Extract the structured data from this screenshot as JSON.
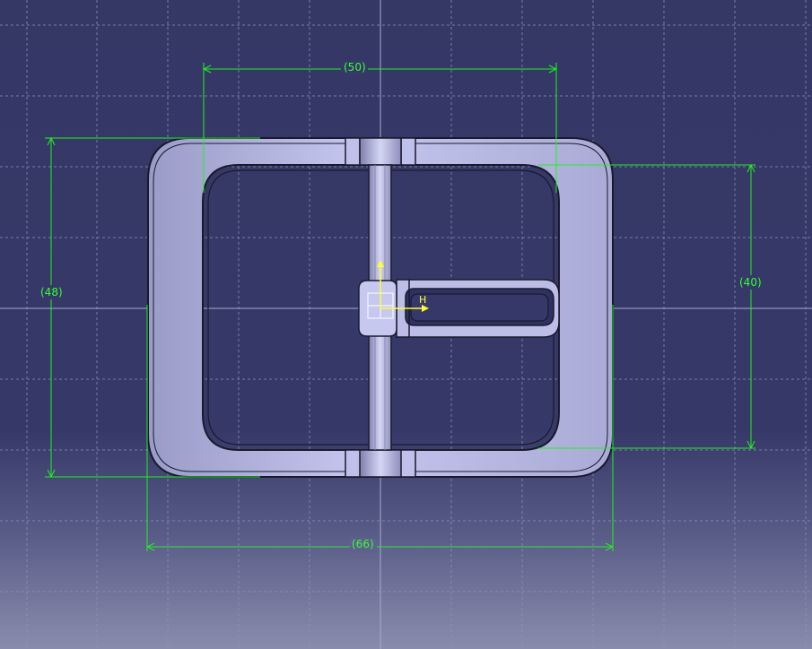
{
  "viewer": {
    "background_top": "#353865",
    "background_bottom": "#8a8cad",
    "grid_color": "#8f92b8",
    "dimension_color": "#22ee22",
    "part_color": "#aeb0dc",
    "axis_color": "#ffff33"
  },
  "dimensions": {
    "inner_width": "(50)",
    "outer_height": "(48)",
    "inner_height": "(40)",
    "outer_width": "(66)"
  },
  "axis": {
    "h_label": "H"
  }
}
